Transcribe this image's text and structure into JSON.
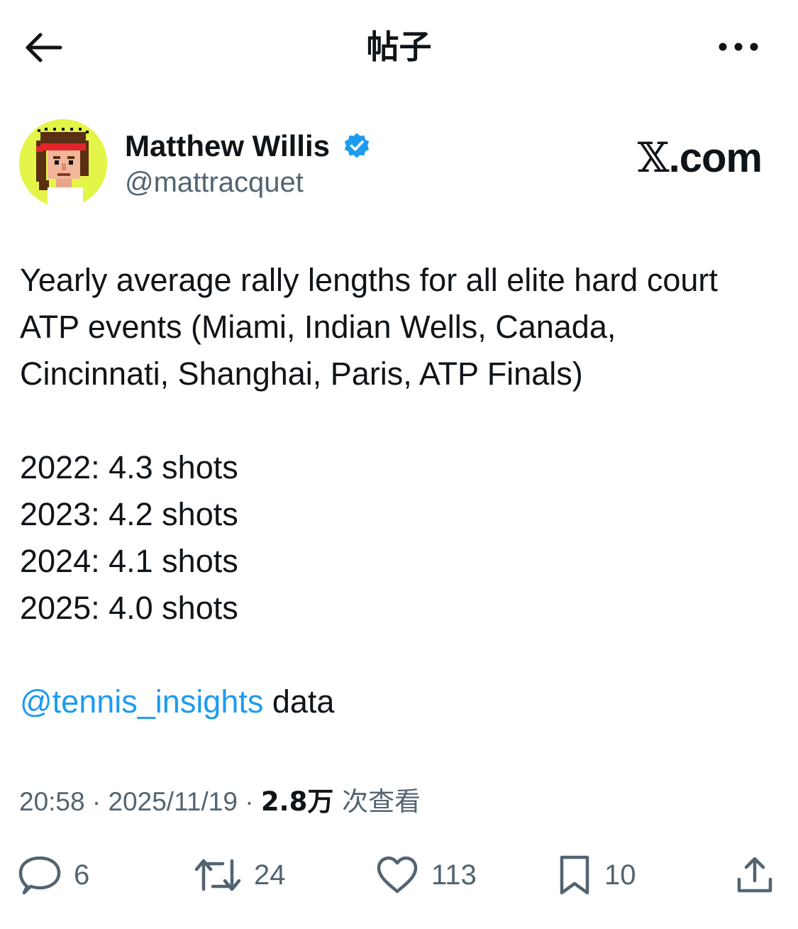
{
  "header": {
    "title": "帖子"
  },
  "author": {
    "display_name": "Matthew Willis",
    "handle": "@mattracquet",
    "verified": true
  },
  "brand": {
    "x_symbol": "𝕏",
    "suffix": ".com"
  },
  "tweet": {
    "lines": [
      "Yearly average rally lengths for all elite hard court",
      "ATP events (Miami, Indian Wells, Canada,",
      "Cincinnati, Shanghai, Paris, ATP Finals)"
    ],
    "stats": [
      "2022: 4.3 shots",
      "2023: 4.2 shots",
      "2024: 4.1 shots",
      "2025: 4.0 shots"
    ],
    "mention": "@tennis_insights",
    "after_mention": " data"
  },
  "meta": {
    "time": "20:58",
    "separator": " · ",
    "date": "2025/11/19",
    "views_count": "2.8万",
    "views_label": " 次查看"
  },
  "actions": {
    "reply_count": "6",
    "repost_count": "24",
    "like_count": "113",
    "bookmark_count": "10"
  },
  "colors": {
    "text": "#0f1419",
    "secondary": "#536471",
    "accent": "#1d9bf0",
    "avatar_bg": "#e4f54a"
  },
  "icons": {
    "back": "arrow-left-icon",
    "more": "more-horizontal-icon",
    "verified": "verified-badge-icon",
    "reply": "reply-bubble-icon",
    "repost": "repost-icon",
    "like": "heart-icon",
    "bookmark": "bookmark-icon",
    "share": "share-upload-icon"
  }
}
